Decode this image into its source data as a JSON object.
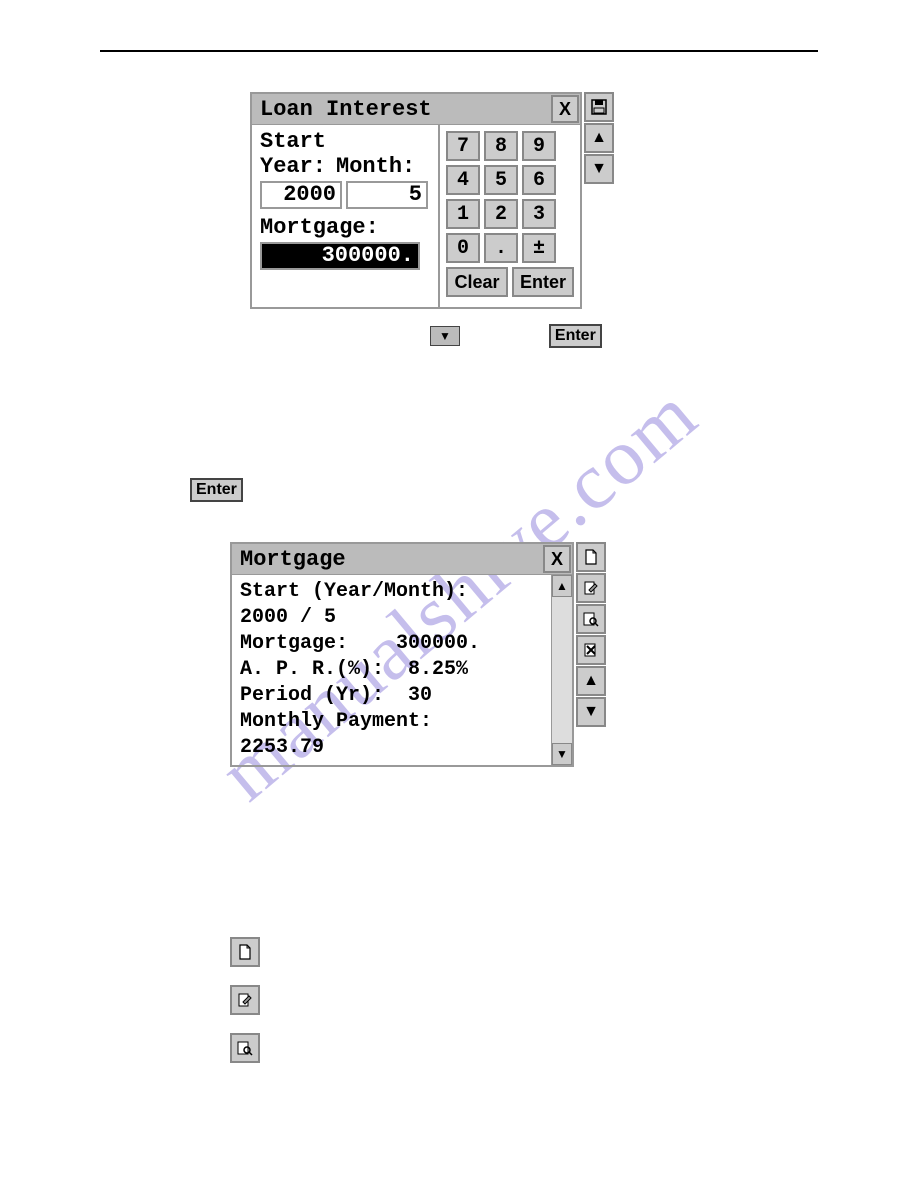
{
  "watermark": "manualshive.com",
  "dialog1": {
    "title": "Loan Interest",
    "close": "X",
    "startLabel": "Start",
    "yearLabel": "Year:",
    "monthLabel": "Month:",
    "yearValue": "2000",
    "monthValue": "5",
    "mortgageLabel": "Mortgage:",
    "mortgageValue": "300000.",
    "keypad": {
      "r1": [
        "7",
        "8",
        "9"
      ],
      "r2": [
        "4",
        "5",
        "6"
      ],
      "r3": [
        "1",
        "2",
        "3"
      ],
      "r4": [
        "0",
        ".",
        "±"
      ],
      "clear": "Clear",
      "enter": "Enter"
    },
    "sideIcons": {
      "save": "save-icon",
      "up": "▲",
      "down": "▼"
    }
  },
  "inline": {
    "dropdown": "▼",
    "enter": "Enter"
  },
  "standaloneEnter": "Enter",
  "result": {
    "title": "Mortgage",
    "close": "X",
    "lines": {
      "l1": "Start (Year/Month):",
      "l2": "2000 / 5",
      "l3a": "Mortgage:",
      "l3b": "300000.",
      "l4a": "A. P. R.(%):",
      "l4b": "8.25%",
      "l5a": "Period (Yr):",
      "l5b": "30",
      "l6": "Monthly Payment:",
      "l7": "2253.79"
    },
    "scroll": {
      "up": "▲",
      "down": "▼"
    },
    "sideIcons": {
      "new": "new-doc-icon",
      "edit": "edit-icon",
      "search": "search-icon",
      "delete": "delete-icon",
      "upArr": "▲",
      "downArr": "▼"
    }
  },
  "iconList": {
    "new": "new-doc-icon",
    "edit": "edit-icon",
    "search": "search-icon"
  }
}
